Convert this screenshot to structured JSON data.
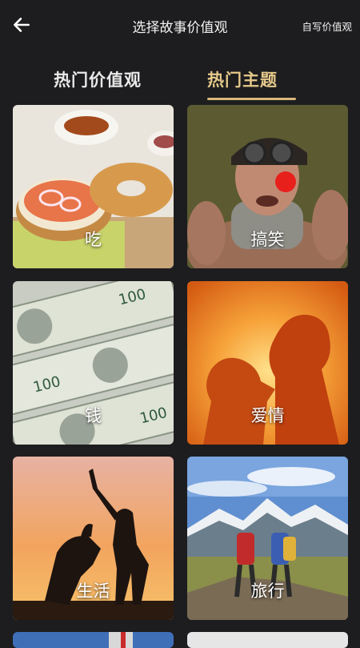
{
  "header": {
    "title": "选择故事价值观",
    "custom_label": "自写价值观",
    "back_icon": "arrow-left-icon"
  },
  "tabs": [
    {
      "label": "热门价值观",
      "active": false
    },
    {
      "label": "热门主题",
      "active": true
    }
  ],
  "accent_color": "#d9b879",
  "topics": [
    {
      "label": "吃"
    },
    {
      "label": "搞笑"
    },
    {
      "label": "钱"
    },
    {
      "label": "爱情"
    },
    {
      "label": "生活"
    },
    {
      "label": "旅行"
    }
  ]
}
